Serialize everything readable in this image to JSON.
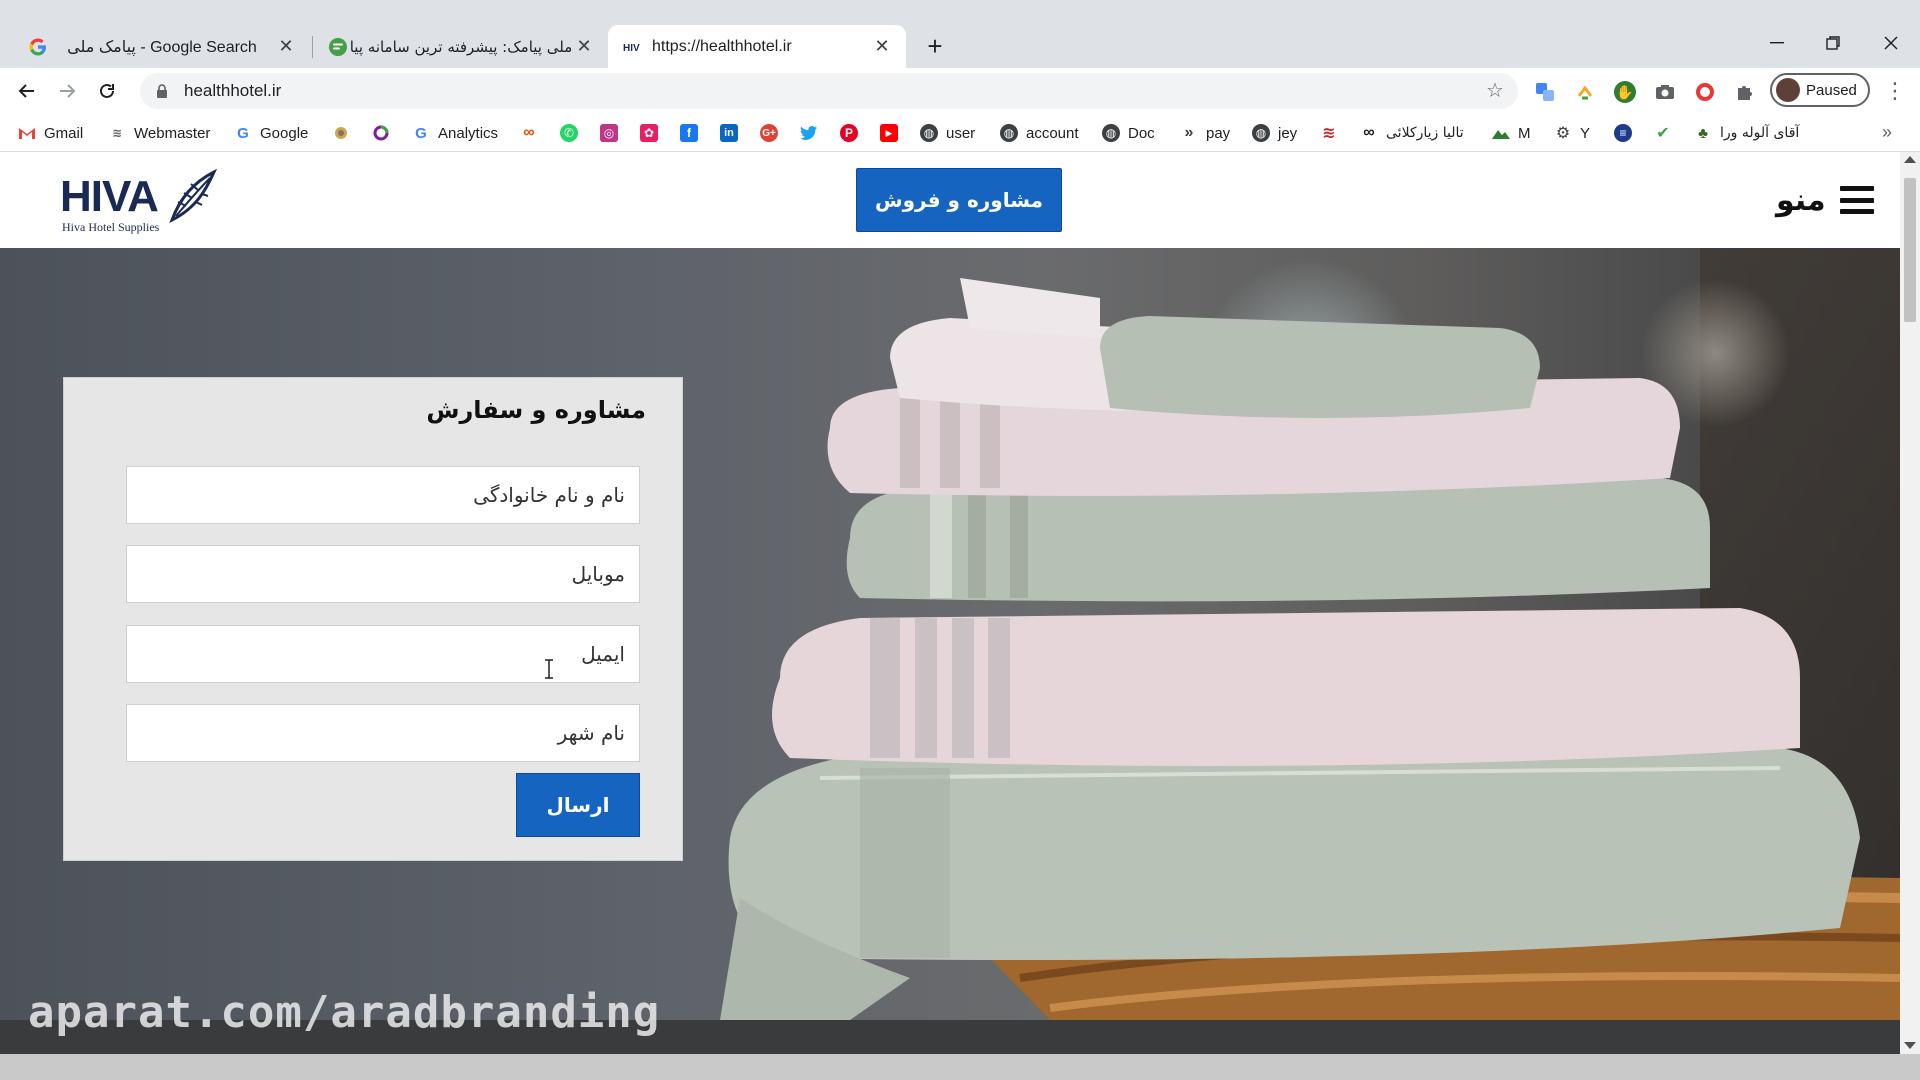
{
  "browser": {
    "tabs": [
      {
        "title": "پیامک ملی - Google Search",
        "favicon": "google-icon",
        "active": false
      },
      {
        "title": "ملی پیامک: پیشرفته ترین سامانه پیا",
        "favicon": "sms-icon",
        "active": false
      },
      {
        "title": "https://healthhotel.ir",
        "favicon": "site-icon",
        "active": true
      }
    ],
    "new_tab_label": "+",
    "url": "healthhotel.ir",
    "profile_label": "Paused",
    "bookmarks": [
      {
        "label": "Gmail",
        "icon": "gmail-icon"
      },
      {
        "label": "Webmaster",
        "icon": "webmaster-icon"
      },
      {
        "label": "Google",
        "icon": "google-icon"
      },
      {
        "label": "",
        "icon": "badge-icon"
      },
      {
        "label": "",
        "icon": "ring-icon"
      },
      {
        "label": "Analytics",
        "icon": "google-icon"
      },
      {
        "label": "",
        "icon": "infinity-icon"
      },
      {
        "label": "",
        "icon": "whatsapp-icon"
      },
      {
        "label": "",
        "icon": "instagram-icon"
      },
      {
        "label": "",
        "icon": "flower-icon"
      },
      {
        "label": "",
        "icon": "facebook-icon"
      },
      {
        "label": "",
        "icon": "linkedin-icon"
      },
      {
        "label": "",
        "icon": "google-plus-icon"
      },
      {
        "label": "",
        "icon": "twitter-icon"
      },
      {
        "label": "",
        "icon": "pinterest-icon"
      },
      {
        "label": "",
        "icon": "youtube-icon"
      },
      {
        "label": "user",
        "icon": "globe-icon"
      },
      {
        "label": "account",
        "icon": "globe-icon"
      },
      {
        "label": "Doc",
        "icon": "globe-icon"
      },
      {
        "label": "pay",
        "icon": "chevron-icon"
      },
      {
        "label": "jey",
        "icon": "globe-icon"
      },
      {
        "label": "",
        "icon": "stack-icon"
      },
      {
        "label": "تالیا زیارکلائی",
        "icon": "infinity-icon"
      },
      {
        "label": "M",
        "icon": "mountain-icon"
      },
      {
        "label": "Y",
        "icon": "settings-icon"
      },
      {
        "label": "",
        "icon": "coin-icon"
      },
      {
        "label": "",
        "icon": "check-icon"
      },
      {
        "label": "آقای آلوله ورا",
        "icon": "plant-icon"
      }
    ],
    "bookmarks_overflow": "»",
    "colors": {
      "accent": "#1565c0",
      "chrome": "#dee1e6"
    }
  },
  "site": {
    "logo_text": "HIVA",
    "logo_subtitle": "Hiva Hotel Supplies",
    "consult_button": "مشاوره و فروش",
    "menu_label": "منو",
    "form": {
      "title": "مشاوره و سفارش",
      "fields": [
        {
          "placeholder": "نام و نام خانوادگی"
        },
        {
          "placeholder": "موبایل"
        },
        {
          "placeholder": "ایمیل"
        },
        {
          "placeholder": "نام شهر"
        }
      ],
      "submit": "ارسال"
    }
  },
  "overlay": {
    "watermark": "aparat.com/aradbranding"
  }
}
